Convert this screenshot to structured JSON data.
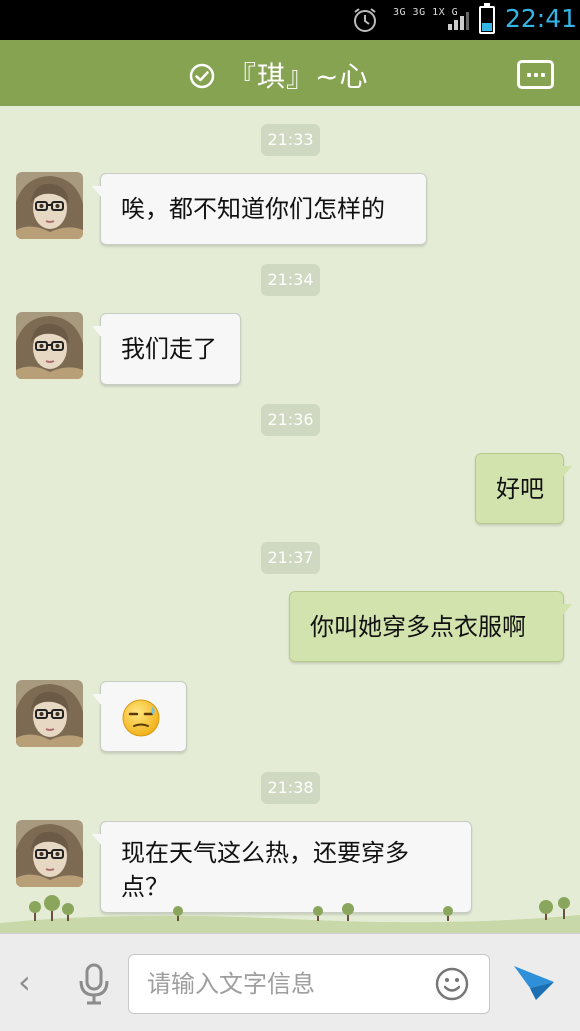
{
  "status_bar": {
    "network_labels": "3G 3G 1X G",
    "time": "22:41",
    "battery_level": 0.32,
    "icons": [
      "alarm-icon",
      "signal-icon",
      "battery-icon"
    ]
  },
  "header": {
    "title": "『琪』~心",
    "icons": [
      "check-circle-icon",
      "menu-dots-icon"
    ]
  },
  "messages": [
    {
      "type": "time",
      "text": "21:33"
    },
    {
      "type": "incoming",
      "text": "唉，都不知道你们怎样的"
    },
    {
      "type": "time",
      "text": "21:34"
    },
    {
      "type": "incoming",
      "text": "我们走了"
    },
    {
      "type": "time",
      "text": "21:36"
    },
    {
      "type": "outgoing",
      "text": "好吧"
    },
    {
      "type": "time",
      "text": "21:37"
    },
    {
      "type": "outgoing",
      "text": "你叫她穿多点衣服啊"
    },
    {
      "type": "incoming",
      "emoji": "sweat-face-emoji"
    },
    {
      "type": "time",
      "text": "21:38"
    },
    {
      "type": "incoming",
      "text_line1": "现在天气这么热，还要穿多",
      "text_line2": "点？"
    }
  ],
  "input_bar": {
    "placeholder": "请输入文字信息",
    "icons": [
      "back-chevron-icon",
      "microphone-icon",
      "smiley-icon",
      "send-icon"
    ]
  },
  "colors": {
    "header_green": "#85a350",
    "chat_background": "#e4ecd6",
    "outgoing_bubble": "#d2e3ae",
    "incoming_bubble": "#f7f7f7",
    "clock_blue": "#33b5e5"
  }
}
